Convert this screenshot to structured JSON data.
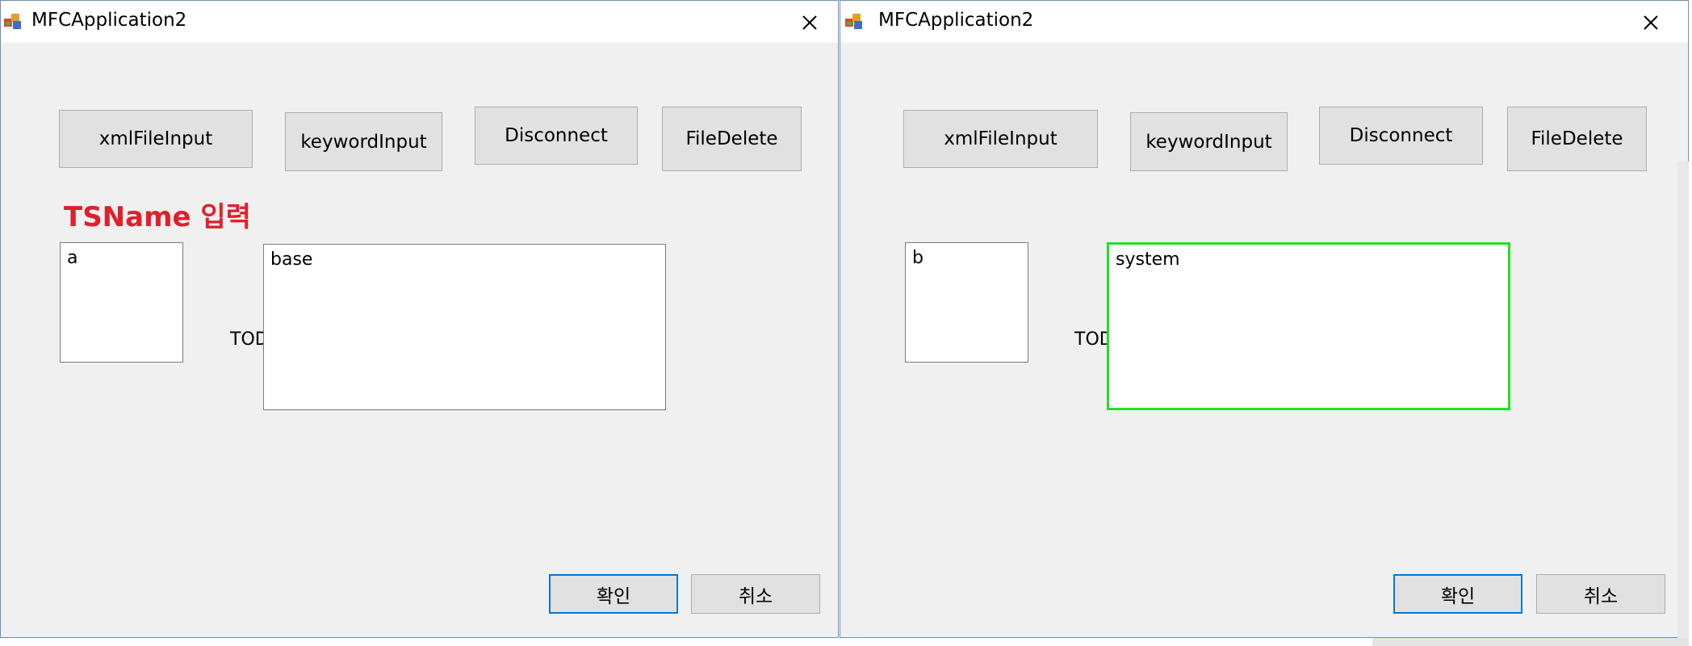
{
  "windows": [
    {
      "title": "MFCApplication2",
      "buttons": {
        "xml": "xmlFileInput",
        "keyword": "keywordInput",
        "disconnect": "Disconnect",
        "delete": "FileDelete",
        "ok": "확인",
        "cancel": "취소"
      },
      "heading": "TSName 입력",
      "small_edit_value": "a",
      "static_label": "TOD",
      "large_edit_value": "base"
    },
    {
      "title": "MFCApplication2",
      "buttons": {
        "xml": "xmlFileInput",
        "keyword": "keywordInput",
        "disconnect": "Disconnect",
        "delete": "FileDelete",
        "ok": "확인",
        "cancel": "취소"
      },
      "small_edit_value": "b",
      "static_label": "TOD",
      "large_edit_value": "system",
      "highlight_color": "#22e022"
    }
  ],
  "colors": {
    "accent": "#0078d7",
    "heading": "#e0202c",
    "dialog_bg": "#f0f0f0"
  },
  "icons": [
    "app-icon",
    "close-icon"
  ]
}
